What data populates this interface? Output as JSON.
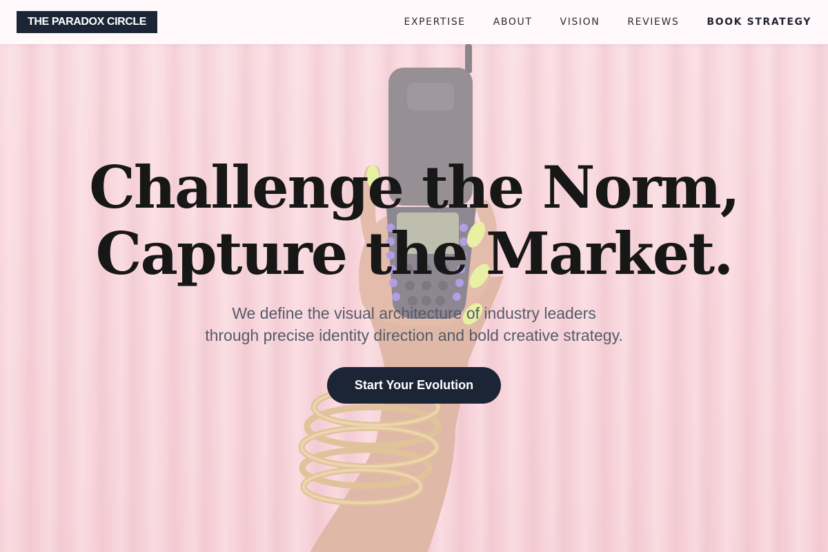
{
  "brand": {
    "logo_text": "THE PARADOX CIRCLE"
  },
  "nav": {
    "items": [
      {
        "label": "EXPERTISE"
      },
      {
        "label": "ABOUT"
      },
      {
        "label": "VISION"
      },
      {
        "label": "REVIEWS"
      }
    ],
    "cta_label": "BOOK STRATEGY"
  },
  "hero": {
    "headline_line1": "Challenge the Norm,",
    "headline_line2": "Capture the Market.",
    "sub_line1": "We define the visual architecture of industry leaders",
    "sub_line2": "through precise identity direction and bold creative strategy.",
    "cta_label": "Start Your Evolution",
    "image_subject": "hand holding flip phone with gold chain bracelets against pink curtain"
  },
  "colors": {
    "accent": "#1c2536",
    "background": "#f4c6cf",
    "headline": "#171717",
    "subtext": "#565b68"
  }
}
